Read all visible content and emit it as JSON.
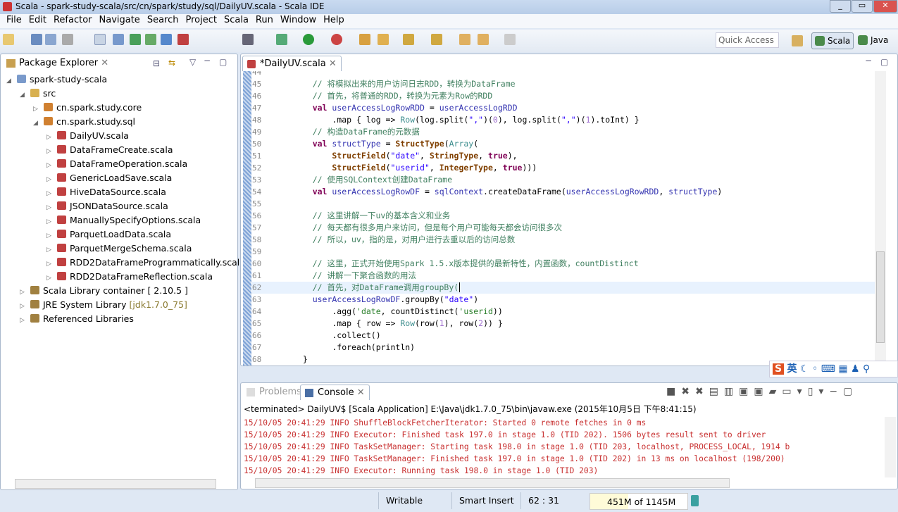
{
  "window": {
    "title": "Scala - spark-study-scala/src/cn/spark/study/sql/DailyUV.scala - Scala IDE"
  },
  "menu": [
    "File",
    "Edit",
    "Refactor",
    "Navigate",
    "Search",
    "Project",
    "Scala",
    "Run",
    "Window",
    "Help"
  ],
  "toolbar": {
    "quick_access_placeholder": "Quick Access",
    "perspectives": [
      {
        "label": "Scala",
        "active": true
      },
      {
        "label": "Java",
        "active": false
      }
    ]
  },
  "package_explorer": {
    "tab": "Package Explorer",
    "tree": [
      {
        "label": "spark-study-scala",
        "level": 0,
        "kind": "project",
        "expanded": true
      },
      {
        "label": "src",
        "level": 1,
        "kind": "folder",
        "expanded": true
      },
      {
        "label": "cn.spark.study.core",
        "level": 2,
        "kind": "package",
        "expanded": false
      },
      {
        "label": "cn.spark.study.sql",
        "level": 2,
        "kind": "package",
        "expanded": true
      },
      {
        "label": "DailyUV.scala",
        "level": 3,
        "kind": "file"
      },
      {
        "label": "DataFrameCreate.scala",
        "level": 3,
        "kind": "file"
      },
      {
        "label": "DataFrameOperation.scala",
        "level": 3,
        "kind": "file"
      },
      {
        "label": "GenericLoadSave.scala",
        "level": 3,
        "kind": "file"
      },
      {
        "label": "HiveDataSource.scala",
        "level": 3,
        "kind": "file"
      },
      {
        "label": "JSONDataSource.scala",
        "level": 3,
        "kind": "file"
      },
      {
        "label": "ManuallySpecifyOptions.scala",
        "level": 3,
        "kind": "file"
      },
      {
        "label": "ParquetLoadData.scala",
        "level": 3,
        "kind": "file"
      },
      {
        "label": "ParquetMergeSchema.scala",
        "level": 3,
        "kind": "file"
      },
      {
        "label": "RDD2DataFrameProgrammatically.scala",
        "level": 3,
        "kind": "file"
      },
      {
        "label": "RDD2DataFrameReflection.scala",
        "level": 3,
        "kind": "file"
      },
      {
        "label": "Scala Library container [ 2.10.5 ]",
        "level": 1,
        "kind": "library"
      },
      {
        "label": "JRE System Library",
        "suffix": "[jdk1.7.0_75]",
        "level": 1,
        "kind": "library"
      },
      {
        "label": "Referenced Libraries",
        "level": 1,
        "kind": "library"
      }
    ]
  },
  "editor": {
    "tab": "*DailyUV.scala",
    "cursor_line": 62,
    "lines": [
      {
        "n": "44",
        "t": []
      },
      {
        "n": "45",
        "t": [
          [
            "cm",
            "    // 将模拟出来的用户访问日志RDD，转换为DataFrame"
          ]
        ]
      },
      {
        "n": "46",
        "t": [
          [
            "cm",
            "    // 首先，将普通的RDD，转换为元素为Row的RDD"
          ]
        ]
      },
      {
        "n": "47",
        "t": [
          [
            "kw",
            "    val "
          ],
          [
            "fd",
            "userAccessLogRowRDD"
          ],
          [
            "pl",
            " = "
          ],
          [
            "fd",
            "userAccessLogRDD"
          ]
        ]
      },
      {
        "n": "48",
        "t": [
          [
            "pl",
            "        .map { log => "
          ],
          [
            "tl",
            "Row"
          ],
          [
            "pl",
            "(log.split("
          ],
          [
            "st",
            "\",\""
          ],
          [
            "pl",
            ")("
          ],
          [
            "nm",
            "0"
          ],
          [
            "pl",
            "), log.split("
          ],
          [
            "st",
            "\",\""
          ],
          [
            "pl",
            ")("
          ],
          [
            "nm",
            "1"
          ],
          [
            "pl",
            ").toInt) }"
          ]
        ]
      },
      {
        "n": "49",
        "t": [
          [
            "cm",
            "    // 构造DataFrame的元数据"
          ]
        ]
      },
      {
        "n": "50",
        "t": [
          [
            "kw",
            "    val "
          ],
          [
            "fd",
            "structType"
          ],
          [
            "pl",
            " = "
          ],
          [
            "ty",
            "StructType"
          ],
          [
            "pl",
            "("
          ],
          [
            "tl",
            "Array"
          ],
          [
            "pl",
            "("
          ]
        ]
      },
      {
        "n": "51",
        "t": [
          [
            "ty",
            "        StructField"
          ],
          [
            "pl",
            "("
          ],
          [
            "st",
            "\"date\""
          ],
          [
            "pl",
            ", "
          ],
          [
            "ty",
            "StringType"
          ],
          [
            "pl",
            ", "
          ],
          [
            "kw",
            "true"
          ],
          [
            "pl",
            "),"
          ]
        ]
      },
      {
        "n": "52",
        "t": [
          [
            "ty",
            "        StructField"
          ],
          [
            "pl",
            "("
          ],
          [
            "st",
            "\"userid\""
          ],
          [
            "pl",
            ", "
          ],
          [
            "ty",
            "IntegerType"
          ],
          [
            "pl",
            ", "
          ],
          [
            "kw",
            "true"
          ],
          [
            "pl",
            ")))"
          ]
        ]
      },
      {
        "n": "53",
        "t": [
          [
            "cm",
            "    // 使用SQLContext创建DataFrame"
          ]
        ]
      },
      {
        "n": "54",
        "t": [
          [
            "kw",
            "    val "
          ],
          [
            "fd",
            "userAccessLogRowDF"
          ],
          [
            "pl",
            " = "
          ],
          [
            "fd",
            "sqlContext"
          ],
          [
            "pl",
            ".createDataFrame("
          ],
          [
            "fd",
            "userAccessLogRowRDD"
          ],
          [
            "pl",
            ", "
          ],
          [
            "fd",
            "structType"
          ],
          [
            "pl",
            ")"
          ]
        ]
      },
      {
        "n": "55",
        "t": []
      },
      {
        "n": "56",
        "t": [
          [
            "cm",
            "    // 这里讲解一下uv的基本含义和业务"
          ]
        ]
      },
      {
        "n": "57",
        "t": [
          [
            "cm",
            "    // 每天都有很多用户来访问，但是每个用户可能每天都会访问很多次"
          ]
        ]
      },
      {
        "n": "58",
        "t": [
          [
            "cm",
            "    // 所以，uv，指的是，对用户进行去重以后的访问总数"
          ]
        ]
      },
      {
        "n": "59",
        "t": []
      },
      {
        "n": "60",
        "t": [
          [
            "cm",
            "    // 这里，正式开始使用Spark 1.5.x版本提供的最新特性，内置函数，countDistinct"
          ]
        ]
      },
      {
        "n": "61",
        "t": [
          [
            "cm",
            "    // 讲解一下聚合函数的用法"
          ]
        ]
      },
      {
        "n": "62",
        "t": [
          [
            "cm",
            "    // 首先，对DataFrame调用groupBy("
          ]
        ]
      },
      {
        "n": "63",
        "t": [
          [
            "fd",
            "    userAccessLogRowDF"
          ],
          [
            "pl",
            ".groupBy("
          ],
          [
            "st",
            "\"date\""
          ],
          [
            "pl",
            ")"
          ]
        ]
      },
      {
        "n": "64",
        "t": [
          [
            "pl",
            "        .agg("
          ],
          [
            "sy",
            "'date"
          ],
          [
            "pl",
            ", countDistinct("
          ],
          [
            "sy",
            "'userid"
          ],
          [
            "pl",
            "))"
          ]
        ]
      },
      {
        "n": "65",
        "t": [
          [
            "pl",
            "        .map { row => "
          ],
          [
            "tl",
            "Row"
          ],
          [
            "pl",
            "(row("
          ],
          [
            "nm",
            "1"
          ],
          [
            "pl",
            "), row("
          ],
          [
            "nm",
            "2"
          ],
          [
            "pl",
            ")) }"
          ]
        ]
      },
      {
        "n": "66",
        "t": [
          [
            "pl",
            "        .collect()"
          ]
        ]
      },
      {
        "n": "67",
        "t": [
          [
            "pl",
            "        .foreach(println)"
          ]
        ]
      },
      {
        "n": "68",
        "t": [
          [
            "pl",
            "  }"
          ]
        ]
      }
    ]
  },
  "console": {
    "tabs": [
      "Problems",
      "Console"
    ],
    "active_tab": "Console",
    "header": "<terminated> DailyUV$ [Scala Application] E:\\Java\\jdk1.7.0_75\\bin\\javaw.exe (2015年10月5日 下午8:41:15)",
    "lines": [
      "15/10/05 20:41:29 INFO ShuffleBlockFetcherIterator: Started 0 remote fetches in 0 ms",
      "15/10/05 20:41:29 INFO Executor: Finished task 197.0 in stage 1.0 (TID 202). 1506 bytes result sent to driver",
      "15/10/05 20:41:29 INFO TaskSetManager: Starting task 198.0 in stage 1.0 (TID 203, localhost, PROCESS_LOCAL, 1914 b",
      "15/10/05 20:41:29 INFO TaskSetManager: Finished task 197.0 in stage 1.0 (TID 202) in 13 ms on localhost (198/200)",
      "15/10/05 20:41:29 INFO Executor: Running task 198.0 in stage 1.0 (TID 203)"
    ]
  },
  "status": {
    "writable": "Writable",
    "insert_mode": "Smart Insert",
    "position": "62 : 31",
    "heap": "451M of 1145M",
    "heap_fraction": 0.39
  },
  "ime": {
    "label": "英"
  }
}
